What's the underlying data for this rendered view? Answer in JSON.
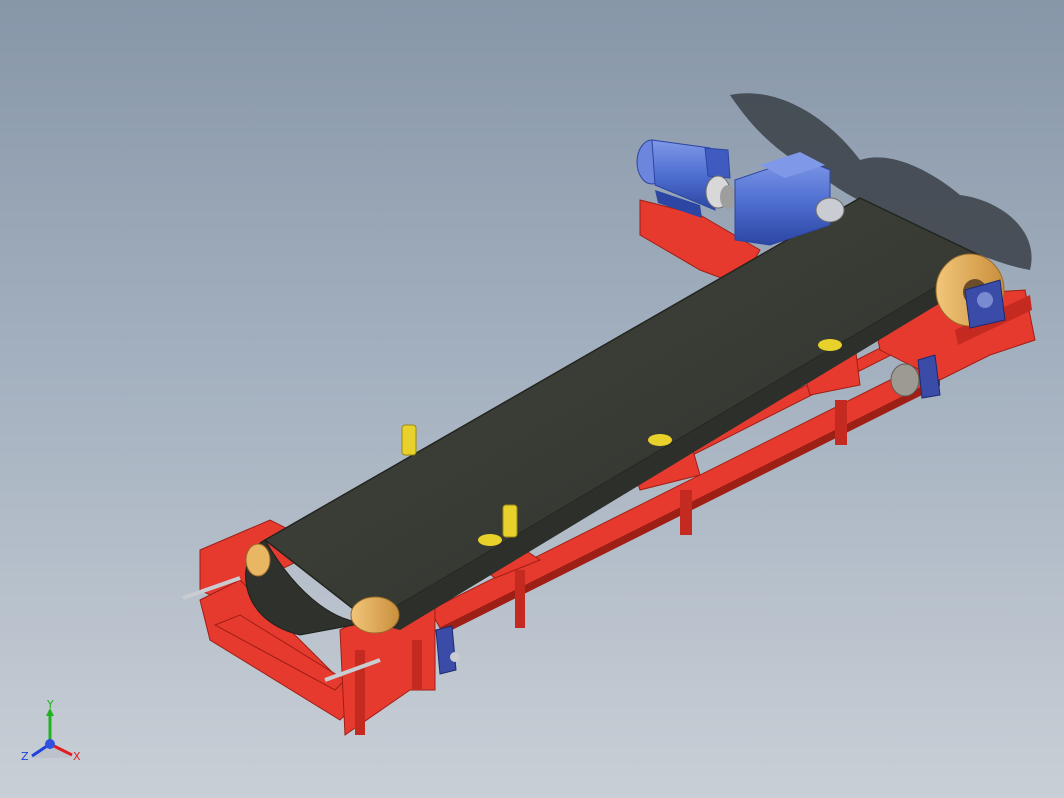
{
  "viewport": {
    "background_top": "#8796a8",
    "background_bottom": "#c9cfd6"
  },
  "colors": {
    "frame_red": "#e63a2e",
    "frame_red_dark": "#9e1f16",
    "belt": "#3b3e39",
    "belt_edge": "#23251f",
    "pulley_face": "#e9b663",
    "motor_blue": "#4f6fd1",
    "motor_blue_dark": "#2c46a3",
    "roller_yellow": "#e8d12a",
    "shaft_grey": "#c9ccd2"
  },
  "triad": {
    "x_label": "X",
    "y_label": "Y",
    "z_label": "Z",
    "x_color": "#e02020",
    "y_color": "#20b020",
    "z_color": "#2040e0"
  }
}
